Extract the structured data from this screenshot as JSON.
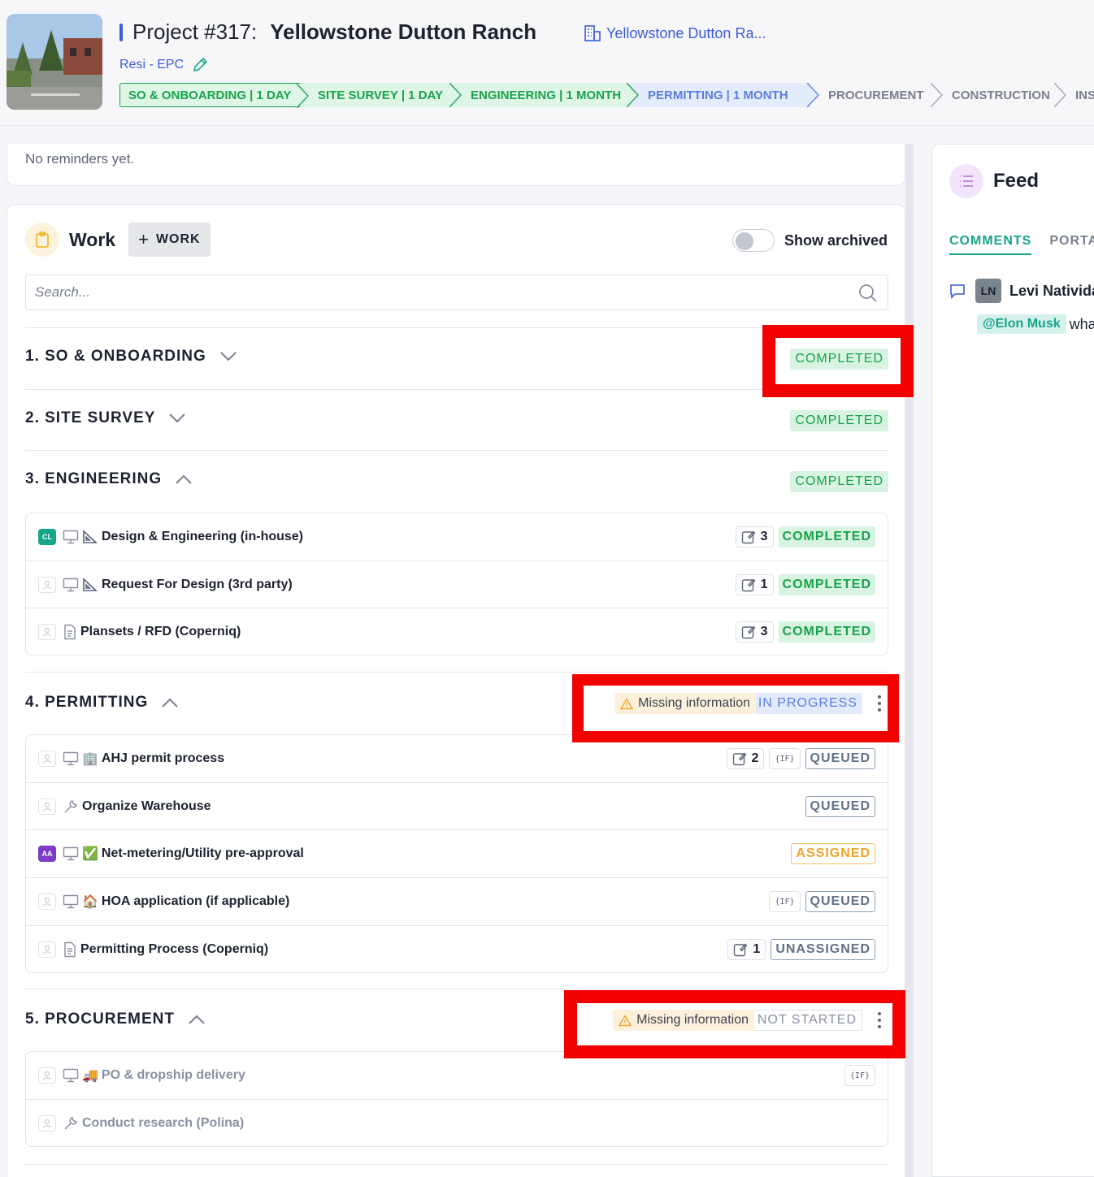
{
  "header": {
    "project_prefix": "Project #317:",
    "project_name": "Yellowstone Dutton Ranch",
    "site_link": "Yellowstone Dutton Ra...",
    "project_type": "Resi - EPC",
    "stages": [
      {
        "label": "SO & ONBOARDING | 1 DAY",
        "state": "done"
      },
      {
        "label": "SITE SURVEY | 1 DAY",
        "state": "done"
      },
      {
        "label": "ENGINEERING | 1 MONTH",
        "state": "done"
      },
      {
        "label": "PERMITTING | 1 MONTH",
        "state": "current"
      },
      {
        "label": "PROCUREMENT",
        "state": "todo"
      },
      {
        "label": "CONSTRUCTION",
        "state": "todo"
      },
      {
        "label": "INSP",
        "state": "todo"
      }
    ]
  },
  "reminders": {
    "empty_text": "No reminders yet."
  },
  "work": {
    "title": "Work",
    "add_label": "WORK",
    "show_archived": "Show archived",
    "search_placeholder": "Search...",
    "phases": [
      {
        "title": "1. SO & ONBOARDING",
        "status": "COMPLETED"
      },
      {
        "title": "2. SITE SURVEY",
        "status": "COMPLETED"
      },
      {
        "title": "3. ENGINEERING",
        "status": "COMPLETED",
        "tasks": [
          {
            "name": "Design & Engineering (in-house)",
            "avatar": "CL",
            "count": "3",
            "status": "COMPLETED"
          },
          {
            "name": "Request For Design (3rd party)",
            "count": "1",
            "status": "COMPLETED"
          },
          {
            "name": "Plansets / RFD (Coperniq)",
            "count": "3",
            "status": "COMPLETED"
          }
        ]
      },
      {
        "title": "4. PERMITTING",
        "warning": "Missing information",
        "status": "IN PROGRESS",
        "tasks": [
          {
            "name": "AHJ permit process",
            "emoji": "🏢",
            "count": "2",
            "if": "{IF}",
            "status": "QUEUED"
          },
          {
            "name": "Organize Warehouse",
            "status": "QUEUED"
          },
          {
            "name": "Net-metering/Utility pre-approval",
            "avatar": "AA",
            "emoji": "✅",
            "status": "ASSIGNED"
          },
          {
            "name": "HOA application (if applicable)",
            "emoji": "🏠",
            "if": "{IF}",
            "status": "QUEUED"
          },
          {
            "name": "Permitting Process (Coperniq)",
            "count": "1",
            "status": "UNASSIGNED"
          }
        ]
      },
      {
        "title": "5. PROCUREMENT",
        "warning": "Missing information",
        "status": "NOT STARTED",
        "tasks": [
          {
            "name": "PO & dropship delivery",
            "emoji": "🚚",
            "if": "{IF}"
          },
          {
            "name": "Conduct research (Polina)"
          }
        ]
      }
    ]
  },
  "feed": {
    "title": "Feed",
    "tabs": [
      "COMMENTS",
      "PORTAL"
    ],
    "comment": {
      "initials": "LN",
      "author": "Levi Natividad",
      "mention": "@Elon Musk",
      "text": "what"
    }
  },
  "colors": {
    "accent": "#3b5bdb",
    "completed": "#17a34a",
    "highlight": "#f20000",
    "teal": "#17a589"
  }
}
